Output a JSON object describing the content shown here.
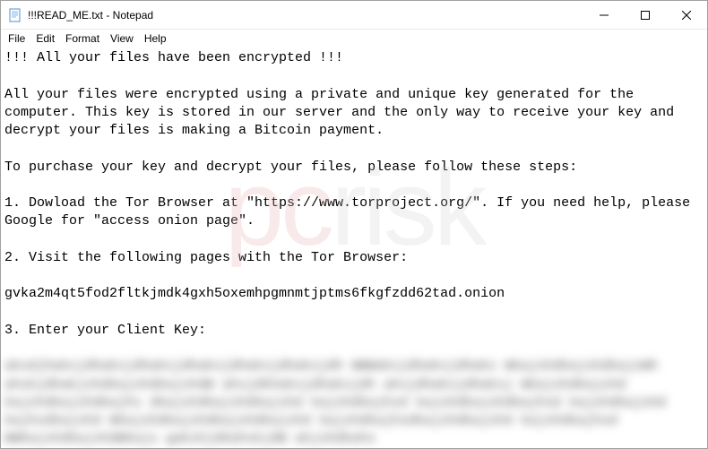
{
  "window": {
    "title": "!!!READ_ME.txt - Notepad"
  },
  "menubar": {
    "file": "File",
    "edit": "Edit",
    "format": "Format",
    "view": "View",
    "help": "Help"
  },
  "content": {
    "line1": "!!! All your files have been encrypted !!!",
    "para1": "All your files were encrypted using a private and unique key generated for the computer. This key is stored in our server and the only way to receive your key and decrypt your files is making a Bitcoin payment.",
    "line2": "To purchase your key and decrypt your files, please follow these steps:",
    "step1": "1. Dowload the Tor Browser at \"https://www.torproject.org/\". If you need help, please Google for \"access onion page\".",
    "step2": "2. Visit the following pages with the Tor Browser:",
    "onion": "gvka2m4qt5fod2fltkjmdk4gxh5oxemhpgmnmtjptms6fkgfzdd62tad.onion",
    "step3": "3. Enter your Client Key:",
    "blurred": "aksdjhaksjdhaksjdhaksjdhaksjdhaksjdhaksjdh WWWaksjdhaksjdhaks WkajshdkajshdkajsWh ahskjdhakjshdkajshdkajshdW ahsjdkhaksjdhaksjdh aksjdhaksjdhaksj Wkajshdkajshd kajshdkajshdkajhs dkajshdkajshdkajshd kajshdkajhsd kajshdkajshdkajhsd kajshdkajshd kajhsdkajshd Wkajshdkajshdkajshdkajshd kajshdkajhsdkajshdkajshd kajshdkajhsd WWkajshdkajshdWkajs gakshjdkahskjdW akjshdkahs"
  },
  "watermark": {
    "left": "pc",
    "right": "risk"
  }
}
